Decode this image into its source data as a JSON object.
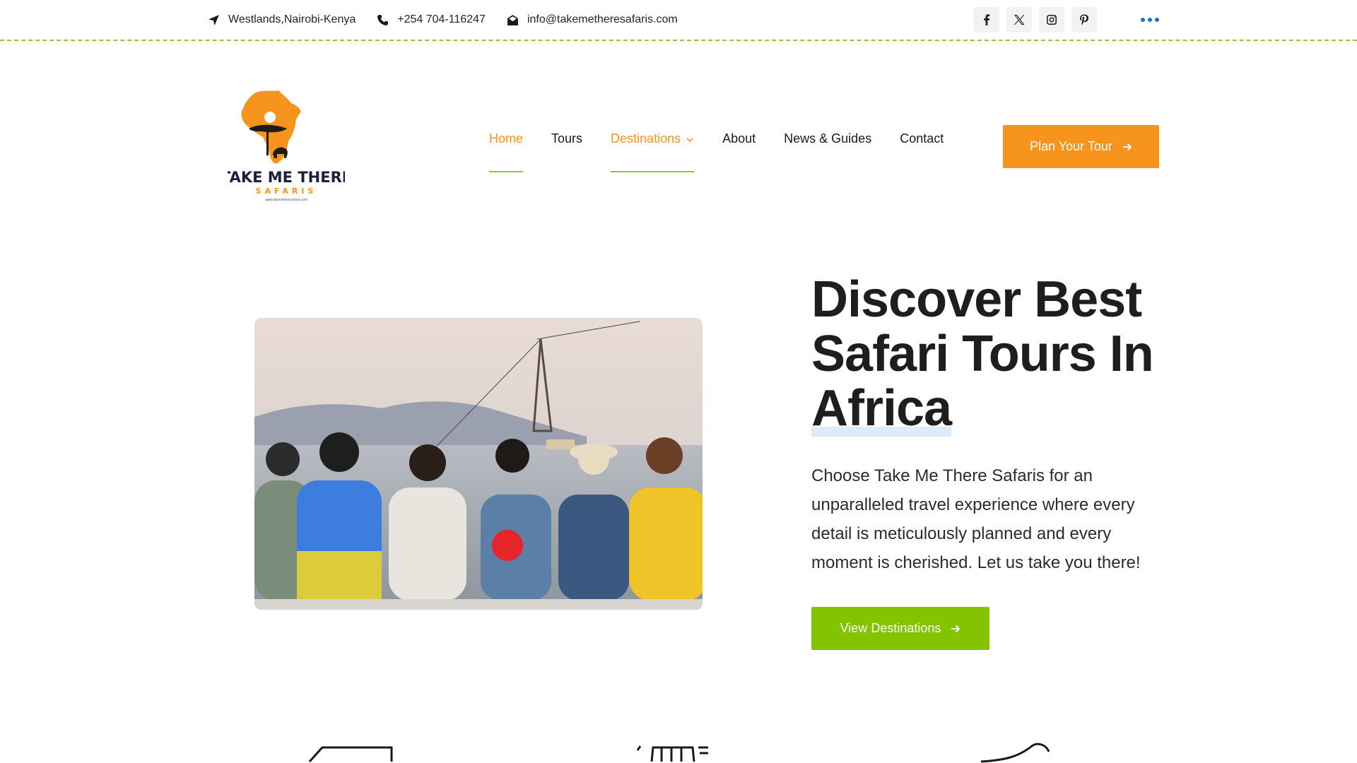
{
  "topbar": {
    "location": "Westlands,Nairobi-Kenya",
    "phone": "+254 704-116247",
    "email": "info@takemetheresafaris.com",
    "socials": [
      "facebook-icon",
      "x-twitter-icon",
      "instagram-icon",
      "pinterest-icon"
    ]
  },
  "header": {
    "logo": {
      "line1": "TAKE ME THERE",
      "line2": "SAFARIS",
      "url": "www.takemetheresafaris.com"
    },
    "nav": [
      {
        "label": "Home",
        "active": true
      },
      {
        "label": "Tours",
        "active": false
      },
      {
        "label": "Destinations",
        "active": true,
        "has_dropdown": true
      },
      {
        "label": "About",
        "active": false
      },
      {
        "label": "News & Guides",
        "active": false
      },
      {
        "label": "Contact",
        "active": false
      }
    ],
    "cta": "Plan Your Tour"
  },
  "hero": {
    "title_line1": "Discover Best",
    "title_line2": "Safari Tours In",
    "title_line3": "Africa",
    "description": "Choose Take Me There Safaris for an unparalleled travel experience where every detail is meticulously planned and every moment is cherished. Let us take you there!",
    "button": "View Destinations",
    "image_alt": "friends sitting arm in arm by the sea"
  },
  "colors": {
    "accent_orange": "#f7941d",
    "accent_green": "#84c300",
    "link_blue": "#1e73be"
  }
}
